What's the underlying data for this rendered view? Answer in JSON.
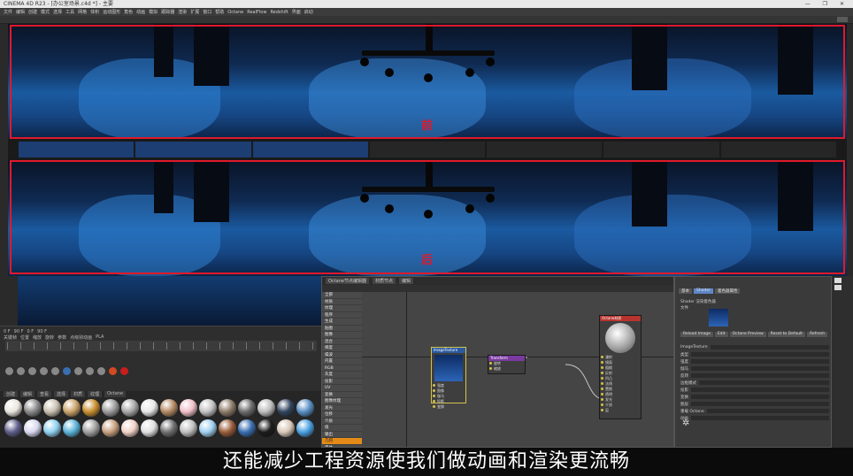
{
  "window": {
    "title": "CINEMA 4D R23 - [办公室场景.c4d *] - 主要",
    "controls": "— ❐ ✕"
  },
  "menu": [
    "文件",
    "编辑",
    "创建",
    "模式",
    "选择",
    "工具",
    "网格",
    "体积",
    "运动图形",
    "角色",
    "动画",
    "模拟",
    "跟踪器",
    "渲染",
    "扩展",
    "窗口",
    "帮助",
    "Octane",
    "RealFlow",
    "Redshift",
    "界面",
    "启动"
  ],
  "viewport": {
    "label_before": "前",
    "label_after": "后"
  },
  "timeline": {
    "frame_row": [
      "0 F",
      "90 F",
      "0 F",
      "90 F"
    ],
    "mode_row": [
      "关键帧",
      "位置",
      "缩放",
      "旋转",
      "参数",
      "点级别动画",
      "PLA"
    ],
    "ruler_ticks": 24
  },
  "material_manager": {
    "tabs": [
      "创建",
      "编辑",
      "查看",
      "选择",
      "材质",
      "纹理",
      "Octane"
    ],
    "swatch_colors": [
      "#e9e6df",
      "#8a8a8a",
      "#c9c0b0",
      "#caa36a",
      "#c98f2f",
      "#9c9c9c",
      "#a8a8a8",
      "#e7e7e7",
      "#b48a63",
      "#f0c0c8",
      "#c3c3c3",
      "#8d7b6a",
      "#6c6c6c",
      "#bdbdbd",
      "#33455f",
      "#5a8fc4",
      "#5e5e8a",
      "#d8d8f0",
      "#8fd0f0",
      "#5bb2d8",
      "#a0a0a0",
      "#c8a080",
      "#f1d2c8",
      "#e0e0e0",
      "#707070",
      "#c0c0c0",
      "#a0d0f0",
      "#9a5c3a",
      "#3a6eb0",
      "#1c1c1c",
      "#d8c8b8",
      "#4aa0e0"
    ]
  },
  "node_editor": {
    "tabs": [
      "Octane节点编辑器",
      "材质节点",
      "编辑"
    ],
    "list": [
      "全部",
      "材质",
      "纹理",
      "程序",
      "生成",
      "贴图",
      "图像",
      "混合",
      "梯度",
      "噪波",
      "内置",
      "RGB",
      "灰度",
      "投影",
      "UV",
      "变换",
      "图像纹理",
      "发光",
      "位移",
      "介质",
      "值",
      "输出",
      "几何",
      "黑体",
      "纹理发光",
      "通道",
      "高斯",
      "衰减",
      "颜色",
      "开关",
      "文件节点"
    ],
    "list_selected_index": 22,
    "nodes": {
      "image": {
        "title": "ImageTexture",
        "ports": [
          "强度",
          "图像",
          "伽马",
          "投影",
          "变换"
        ]
      },
      "transform": {
        "title": "Transform",
        "ports": [
          "旋转",
          "缩放"
        ]
      },
      "material": {
        "title": "Octane材质",
        "ports": [
          "漫射",
          "镜面",
          "粗糙",
          "反射",
          "凹凸",
          "法线",
          "置换",
          "透明",
          "发光",
          "介质",
          "层"
        ]
      }
    }
  },
  "attributes": {
    "tabs": [
      "基本",
      "Shader",
      "着色器属性"
    ],
    "rows": [
      "Shader 渲染着色器",
      "文件",
      "ImageTexture",
      "类型",
      "强度",
      "伽马",
      "反转",
      "边框模式",
      "投影",
      "变换",
      "图层",
      "重载 Octane",
      "动画"
    ],
    "buttons": [
      "Reload Image",
      "Edit",
      "Octane Preview",
      "Reset to Default",
      "Refresh"
    ]
  },
  "subtitle": "还能减少工程资源使我们做动画和渲染更流畅",
  "colors": {
    "highlight": "#e0192b",
    "accent": "#e38a18",
    "scene_blue": "#1a5aa0"
  }
}
